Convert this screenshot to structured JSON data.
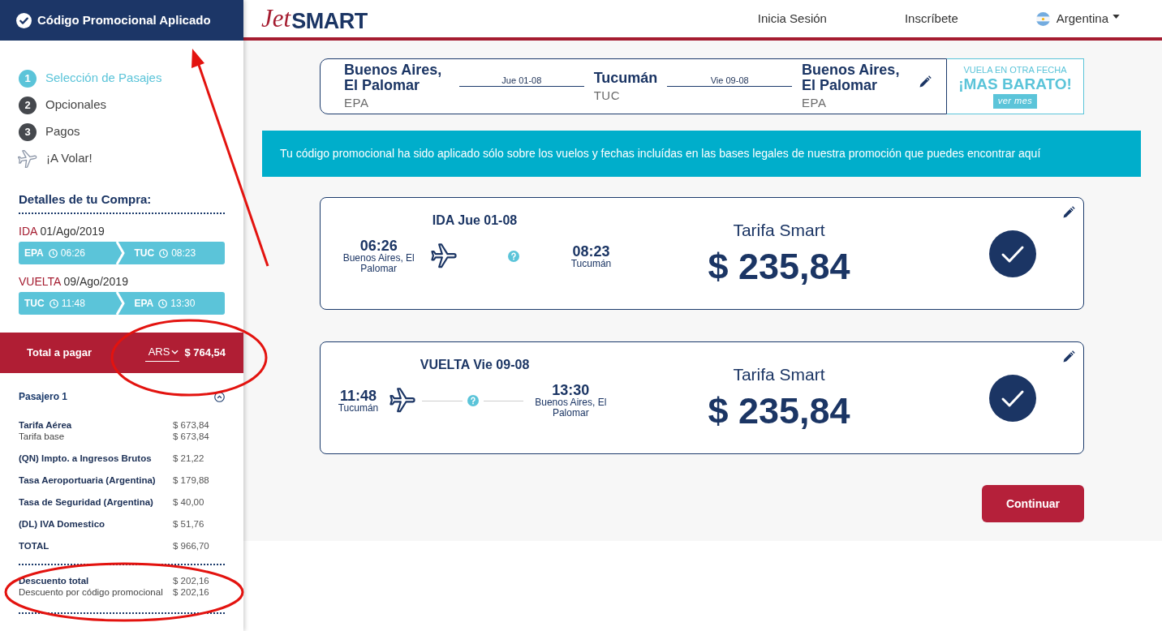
{
  "sidebar": {
    "promo_header": {
      "title": "Código Promocional Aplicado"
    },
    "steps": [
      {
        "kind": "number",
        "number": "1",
        "label": "Selección de Pasajes",
        "selected": true
      },
      {
        "kind": "number",
        "number": "2",
        "label": "Opcionales",
        "selected": false
      },
      {
        "kind": "number",
        "number": "3",
        "label": "Pagos",
        "selected": false
      },
      {
        "kind": "plane",
        "label": "¡A Volar!",
        "selected": false
      }
    ],
    "details_title": "Detalles de tu Compra:",
    "trips": [
      {
        "direction": "IDA",
        "date": "01/Ago/2019",
        "segments": [
          {
            "code": "EPA",
            "time": "06:26"
          },
          {
            "code": "TUC",
            "time": "08:23"
          }
        ]
      },
      {
        "direction": "VUELTA",
        "date": "09/Ago/2019",
        "segments": [
          {
            "code": "TUC",
            "time": "11:48"
          },
          {
            "code": "EPA",
            "time": "13:30"
          }
        ]
      }
    ],
    "total": {
      "label": "Total a pagar",
      "currency": "ARS",
      "amount": "$ 764,54"
    },
    "passenger": {
      "title": "Pasajero 1",
      "expanded": true,
      "charges": [
        {
          "lines": [
            {
              "label": "Tarifa Aérea",
              "amount": "$ 673,84",
              "kind": "head"
            },
            {
              "label": "Tarifa base",
              "amount": "$ 673,84",
              "kind": "detail"
            }
          ]
        },
        {
          "lines": [
            {
              "label": "(QN) Impto. a Ingresos Brutos",
              "amount": "$ 21,22",
              "kind": "head"
            }
          ]
        },
        {
          "lines": [
            {
              "label": "Tasa Aeroportuaria (Argentina)",
              "amount": "$ 179,88",
              "kind": "head"
            }
          ]
        },
        {
          "lines": [
            {
              "label": "Tasa de Seguridad (Argentina)",
              "amount": "$ 40,00",
              "kind": "head"
            }
          ]
        },
        {
          "lines": [
            {
              "label": "(DL) IVA Domestico",
              "amount": "$ 51,76",
              "kind": "head"
            }
          ]
        },
        {
          "lines": [
            {
              "label": "TOTAL",
              "amount": "$ 966,70",
              "kind": "head"
            }
          ]
        }
      ],
      "discounts": [
        {
          "lines": [
            {
              "label": "Descuento total",
              "amount": "$ 202,16",
              "kind": "head"
            },
            {
              "label": "Descuento por código promocional",
              "amount": "$ 202,16",
              "kind": "detail"
            }
          ]
        }
      ]
    }
  },
  "header": {
    "logo": {
      "script": "Jet",
      "word": "SMART"
    },
    "links": [
      {
        "label": "Inicia Sesión"
      },
      {
        "label": "Inscríbete"
      }
    ],
    "country": {
      "label": "Argentina"
    }
  },
  "route_bar": {
    "stops": [
      {
        "city": "Buenos Aires, El Palomar",
        "code": "EPA"
      },
      {
        "city": "Tucumán",
        "code": "TUC"
      },
      {
        "city": "Buenos Aires, El Palomar",
        "code": "EPA"
      }
    ],
    "dates": [
      "Jue 01-08",
      "Vie 09-08"
    ]
  },
  "promo_box": {
    "kicker": "VUELA EN OTRA FECHA",
    "headline": "¡MAS BARATO!",
    "button": "ver mes"
  },
  "banner": {
    "text": "Tu código promocional ha sido aplicado sólo sobre los vuelos y fechas incluídas en las bases legales de nuestra promoción que puedes encontrar aquí"
  },
  "flights": [
    {
      "title": "IDA Jue 01-08",
      "departure": {
        "time": "06:26",
        "city": "Buenos Aires, El Palomar"
      },
      "arrival": {
        "time": "08:23",
        "city": "Tucumán"
      },
      "connector_line": false,
      "fare": "Tarifa Smart",
      "price": "$ 235,84",
      "selected": true
    },
    {
      "title": "VUELTA Vie 09-08",
      "departure": {
        "time": "11:48",
        "city": "Tucumán"
      },
      "arrival": {
        "time": "13:30",
        "city": "Buenos Aires, El Palomar"
      },
      "connector_line": true,
      "fare": "Tarifa Smart",
      "price": "$ 235,84",
      "selected": true
    }
  ],
  "continue_button": {
    "label": "Continuar"
  }
}
